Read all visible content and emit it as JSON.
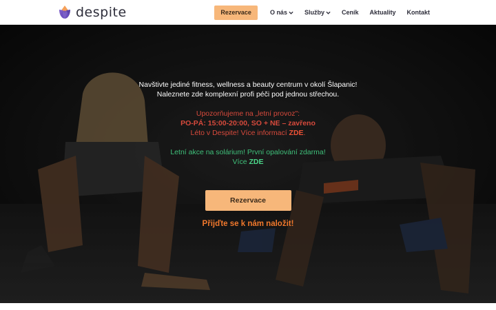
{
  "brand": {
    "name": "despite",
    "colors": {
      "accent": "#f7b77a",
      "alert": "#d84a3c",
      "promo": "#3fc07a",
      "tagline": "#f0782c",
      "text": "#2d2d3a"
    }
  },
  "nav": {
    "reserve_label": "Rezervace",
    "items": [
      {
        "label": "O nás",
        "has_dropdown": true
      },
      {
        "label": "Služby",
        "has_dropdown": true
      },
      {
        "label": "Ceník",
        "has_dropdown": false
      },
      {
        "label": "Aktuality",
        "has_dropdown": false
      },
      {
        "label": "Kontakt",
        "has_dropdown": false
      }
    ]
  },
  "hero": {
    "intro_line1": "Navštivte jediné fitness, wellness a beauty centrum v okolí Šlapanic!",
    "intro_line2": "Naleznete zde komplexní profi péči pod jednou střechou.",
    "notice_line1": "Upozorňujeme na „letní provoz\":",
    "notice_line2": "PO-PÁ: 15:00-20:00, SO + NE – zavřeno",
    "notice_line3_prefix": "Léto v Despite! Více informací ",
    "notice_line3_link": "ZDE",
    "notice_line3_suffix": ".",
    "promo_line1": "Letní akce na solárium! První opalování zdarma!",
    "promo_line2_prefix": "Více ",
    "promo_line2_link": "ZDE",
    "cta_label": "Rezervace",
    "tagline": "Přijďte se k nám naložit!"
  }
}
